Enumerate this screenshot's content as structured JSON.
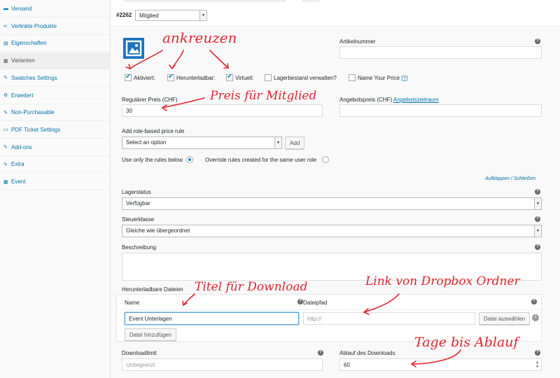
{
  "sidebar": {
    "items": [
      {
        "label": "Versand",
        "icon": "truck-icon",
        "glyph": "▬"
      },
      {
        "label": "Verlinkte Produkte",
        "icon": "link-icon",
        "glyph": "∞"
      },
      {
        "label": "Eigenschaften",
        "icon": "list-icon",
        "glyph": "▤"
      },
      {
        "label": "Varianten",
        "icon": "grid-icon",
        "glyph": "▦"
      },
      {
        "label": "Swatches Settings",
        "icon": "wrench-icon",
        "glyph": "✎"
      },
      {
        "label": "Erweitert",
        "icon": "gear-icon",
        "glyph": "⚙"
      },
      {
        "label": "Non-Purchasable",
        "icon": "wrench-icon",
        "glyph": "✎"
      },
      {
        "label": "PDF Ticket Settings",
        "icon": "pdf-icon",
        "glyph": "▭"
      },
      {
        "label": "Add-ons",
        "icon": "wrench-icon",
        "glyph": "✎"
      },
      {
        "label": "Extra",
        "icon": "wrench-icon",
        "glyph": "✎"
      },
      {
        "label": "Event",
        "icon": "calendar-icon",
        "glyph": "▦"
      }
    ],
    "active_index": 3
  },
  "variation": {
    "id": "#2262",
    "attribute_value": "Mitglied"
  },
  "fields": {
    "sku_label": "Artikelnummer",
    "sku_value": "",
    "checkboxes": [
      {
        "label": "Aktiviert:",
        "checked": true
      },
      {
        "label": "Herunterladbar:",
        "checked": true
      },
      {
        "label": "Virtuell:",
        "checked": true
      },
      {
        "label": "Lagerbestand verwalten?",
        "checked": false
      },
      {
        "label": "Name Your Price",
        "checked": false
      }
    ],
    "name_your_price_help": "[?]",
    "regular_price_label": "Regulärer Preis (CHF)",
    "regular_price_value": "30",
    "sale_price_label": "Angebotspreis (CHF)",
    "sale_schedule_link": "Angebotszeitraum",
    "sale_price_value": "",
    "role_rule_label": "Add role-based price rule",
    "role_rule_select": "Select an option",
    "add_button": "Add",
    "radio_only_label": "Use only the rules below",
    "radio_override_label": "Override rules created for the same user role",
    "expand_collapse": "Aufklappen / Schließen",
    "stock_status_label": "Lagerstatus",
    "stock_status_value": "Verfügbar",
    "tax_class_label": "Steuerklasse",
    "tax_class_value": "Gleiche wie übergeordnet",
    "description_label": "Beschreibung",
    "description_value": ""
  },
  "downloads": {
    "section_label": "Herunterladbare Dateien",
    "col_name": "Name",
    "col_path": "Dateipfad",
    "file_name": "Event Unterlagen",
    "file_path_placeholder": "http://",
    "choose_file_button": "Datei auswählen",
    "add_file_button": "Datei hinzufügen",
    "limit_label": "Downloadlimit",
    "limit_placeholder": "Unbegrenzt",
    "expiry_label": "Ablauf des Downloads",
    "expiry_value": "60"
  },
  "help_glyph": "?",
  "annotations": {
    "mark": "ankreuzen",
    "price": "Preis für Mitglied",
    "title": "Titel für Download",
    "link": "Link von Dropbox Ordner",
    "days": "Tage bis Ablauf"
  },
  "colors": {
    "accent": "#0073aa",
    "annotation": "#e0262f",
    "thumbnail": "#1e73be"
  }
}
